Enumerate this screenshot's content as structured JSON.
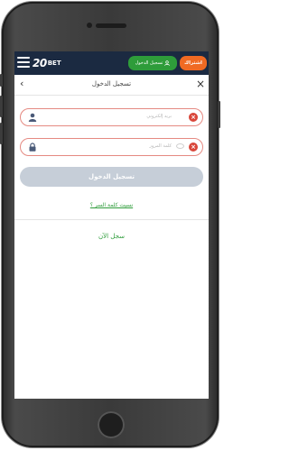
{
  "topbar": {
    "logo_number": "20",
    "logo_text": "BET",
    "login_label": "تسجيل الدخول",
    "signup_label": "اشتراك"
  },
  "header": {
    "title": "تسجيل الدخول"
  },
  "form": {
    "email_placeholder": "بريد إلكتروني",
    "password_placeholder": "كلمة المرور",
    "submit_label": "تسجيل الدخول",
    "forgot_label": "نسيت كلمة السر ؟",
    "register_label": "سجل الآن"
  },
  "colors": {
    "topbar_bg": "#1b2a41",
    "login_green": "#2e9c3a",
    "signup_orange": "#f06a23",
    "error_red": "#d9473b",
    "disabled_button": "#c6ced8"
  },
  "icons": [
    "hamburger-icon",
    "user-icon",
    "back-arrow-icon",
    "close-icon",
    "email-user-icon",
    "lock-icon",
    "eye-icon",
    "error-icon"
  ]
}
